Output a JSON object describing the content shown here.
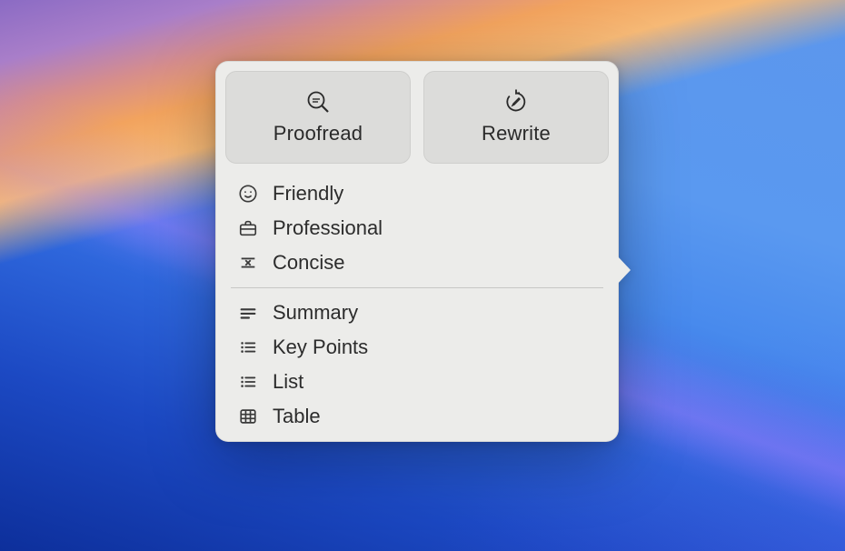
{
  "popover": {
    "top_buttons": {
      "proofread": {
        "label": "Proofread",
        "icon": "proofread-icon"
      },
      "rewrite": {
        "label": "Rewrite",
        "icon": "rewrite-icon"
      }
    },
    "tone_items": [
      {
        "label": "Friendly",
        "icon": "smile-icon"
      },
      {
        "label": "Professional",
        "icon": "briefcase-icon"
      },
      {
        "label": "Concise",
        "icon": "concise-icon"
      }
    ],
    "format_items": [
      {
        "label": "Summary",
        "icon": "summary-icon"
      },
      {
        "label": "Key Points",
        "icon": "bullet-list-icon"
      },
      {
        "label": "List",
        "icon": "bullet-list-icon"
      },
      {
        "label": "Table",
        "icon": "table-icon"
      }
    ]
  }
}
